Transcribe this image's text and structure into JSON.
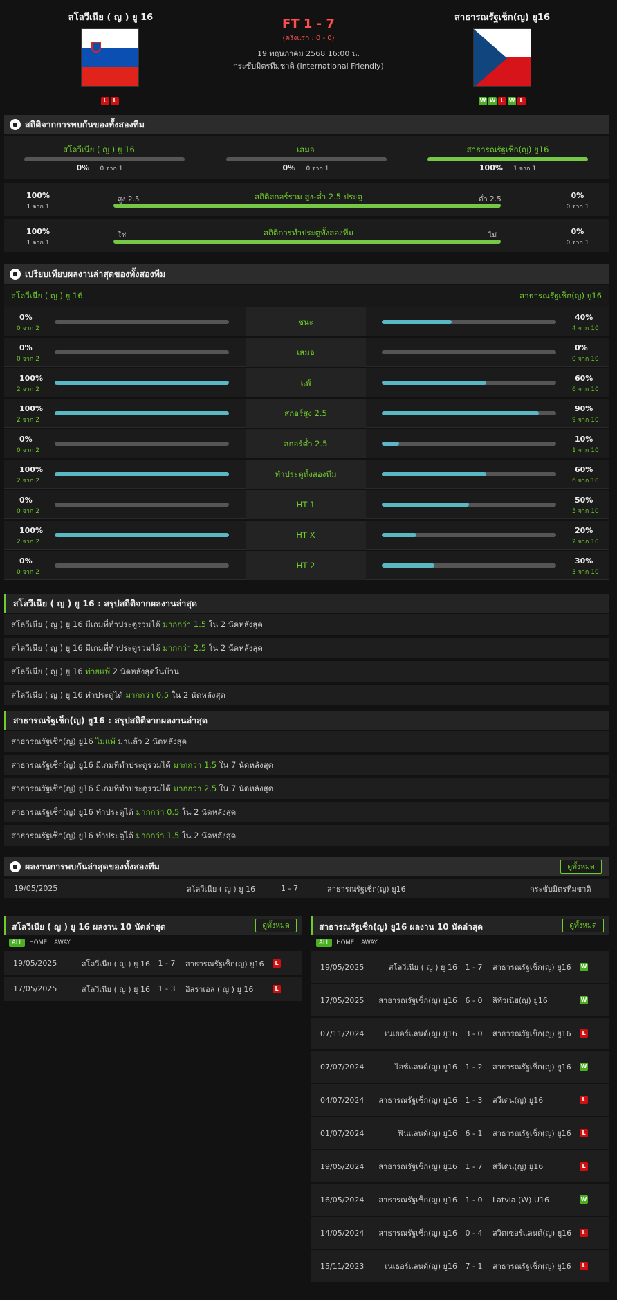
{
  "match": {
    "home_team": "สโลวีเนีย ( ญ ) ยู 16",
    "away_team": "สาธารณรัฐเช็ก(ญ) ยู16",
    "score": "FT 1 - 7",
    "half_time": "(ครึ่งแรก : 0 - 0)",
    "datetime": "19 พฤษภาคม 2568 16:00 น.",
    "competition": "กระชับมิตรทีมชาติ (International Friendly)",
    "home_form": [
      "L",
      "L"
    ],
    "away_form": [
      "W",
      "W",
      "L",
      "W",
      "L"
    ]
  },
  "h2h_stats": {
    "title": "สถิติจากการพบกันของทั้งสองทีม",
    "home_label": "สโลวีเนีย ( ญ ) ยู 16",
    "draw_label": "เสมอ",
    "away_label": "สาธารณรัฐเช็ก(ญ) ยู16",
    "home_pct": "0%",
    "home_sub": "0 จาก 1",
    "home_value": 0,
    "draw_pct": "0%",
    "draw_sub": "0 จาก 1",
    "draw_value": 0,
    "away_pct": "100%",
    "away_sub": "1 จาก 1",
    "away_value": 100,
    "ou": {
      "title": "สถิติสกอร์รวม สูง-ต่ำ 2.5 ประตู",
      "left_label": "สูง 2.5",
      "right_label": "ต่ำ 2.5",
      "left_pct": "100%",
      "left_sub": "1 จาก 1",
      "right_pct": "0%",
      "right_sub": "0 จาก 1",
      "value": 100
    },
    "btts": {
      "title": "สถิติการทำประตูทั้งสองทีม",
      "left_label": "ใช่",
      "right_label": "ไม่",
      "left_pct": "100%",
      "left_sub": "1 จาก 1",
      "right_pct": "0%",
      "right_sub": "0 จาก 1",
      "value": 100
    }
  },
  "compare": {
    "title": "เปรียบเทียบผลงานล่าสุดของทั้งสองทีม",
    "home_team": "สโลวีเนีย ( ญ ) ยู 16",
    "away_team": "สาธารณรัฐเช็ก(ญ) ยู16",
    "rows": [
      {
        "label": "ชนะ",
        "home_pct": "0%",
        "home_sub": "0 จาก 2",
        "home_value": 0,
        "away_pct": "40%",
        "away_sub": "4 จาก 10",
        "away_value": 40
      },
      {
        "label": "เสมอ",
        "home_pct": "0%",
        "home_sub": "0 จาก 2",
        "home_value": 0,
        "away_pct": "0%",
        "away_sub": "0 จาก 10",
        "away_value": 0
      },
      {
        "label": "แพ้",
        "home_pct": "100%",
        "home_sub": "2 จาก 2",
        "home_value": 100,
        "away_pct": "60%",
        "away_sub": "6 จาก 10",
        "away_value": 60
      },
      {
        "label": "สกอร์สูง 2.5",
        "home_pct": "100%",
        "home_sub": "2 จาก 2",
        "home_value": 100,
        "away_pct": "90%",
        "away_sub": "9 จาก 10",
        "away_value": 90
      },
      {
        "label": "สกอร์ต่ำ 2.5",
        "home_pct": "0%",
        "home_sub": "0 จาก 2",
        "home_value": 0,
        "away_pct": "10%",
        "away_sub": "1 จาก 10",
        "away_value": 10
      },
      {
        "label": "ทำประตูทั้งสองทีม",
        "home_pct": "100%",
        "home_sub": "2 จาก 2",
        "home_value": 100,
        "away_pct": "60%",
        "away_sub": "6 จาก 10",
        "away_value": 60
      },
      {
        "label": "HT 1",
        "home_pct": "0%",
        "home_sub": "0 จาก 2",
        "home_value": 0,
        "away_pct": "50%",
        "away_sub": "5 จาก 10",
        "away_value": 50
      },
      {
        "label": "HT X",
        "home_pct": "100%",
        "home_sub": "2 จาก 2",
        "home_value": 100,
        "away_pct": "20%",
        "away_sub": "2 จาก 10",
        "away_value": 20
      },
      {
        "label": "HT 2",
        "home_pct": "0%",
        "home_sub": "0 จาก 2",
        "home_value": 0,
        "away_pct": "30%",
        "away_sub": "3 จาก 10",
        "away_value": 30
      }
    ]
  },
  "home_summary": {
    "title": "สโลวีเนีย ( ญ ) ยู 16 : สรุปสถิติจากผลงานล่าสุด",
    "rows": [
      {
        "pre": "สโลวีเนีย ( ญ ) ยู 16  มีเกมที่ทำประตูรวมได้ ",
        "hl": "มากกว่า  1.5",
        "post": "  ใน 2 นัดหลังสุด"
      },
      {
        "pre": "สโลวีเนีย ( ญ ) ยู 16  มีเกมที่ทำประตูรวมได้ ",
        "hl": "มากกว่า  2.5",
        "post": "  ใน 2 นัดหลังสุด"
      },
      {
        "pre": "สโลวีเนีย ( ญ ) ยู 16  ",
        "hl": "พ่ายแพ้",
        "post": "  2  นัดหลังสุดในบ้าน"
      },
      {
        "pre": "สโลวีเนีย ( ญ ) ยู 16  ทำประตูได้ ",
        "hl": "มากกว่า  0.5",
        "post": "  ใน 2 นัดหลังสุด"
      }
    ]
  },
  "away_summary": {
    "title": "สาธารณรัฐเช็ก(ญ) ยู16 : สรุปสถิติจากผลงานล่าสุด",
    "rows": [
      {
        "pre": "สาธารณรัฐเช็ก(ญ) ยู16  ",
        "hl": "ไม่แพ้",
        "post": "  มาแล้ว 2 นัดหลังสุด"
      },
      {
        "pre": "สาธารณรัฐเช็ก(ญ) ยู16  มีเกมที่ทำประตูรวมได้ ",
        "hl": "มากกว่า  1.5",
        "post": "  ใน 7 นัดหลังสุด"
      },
      {
        "pre": "สาธารณรัฐเช็ก(ญ) ยู16  มีเกมที่ทำประตูรวมได้ ",
        "hl": "มากกว่า  2.5",
        "post": "  ใน 7 นัดหลังสุด"
      },
      {
        "pre": "สาธารณรัฐเช็ก(ญ) ยู16  ทำประตูได้ ",
        "hl": "มากกว่า  0.5",
        "post": "  ใน 2 นัดหลังสุด"
      },
      {
        "pre": "สาธารณรัฐเช็ก(ญ) ยู16  ทำประตูได้ ",
        "hl": "มากกว่า  1.5",
        "post": "  ใน 2 นัดหลังสุด"
      }
    ]
  },
  "h2h_results": {
    "title": "ผลงานการพบกันล่าสุดของทั้งสองทีม",
    "view_all": "ดูทั้งหมด",
    "rows": [
      {
        "date": "19/05/2025",
        "home": "สโลวีเนีย ( ญ ) ยู 16",
        "score": "1 - 7",
        "away": "สาธารณรัฐเช็ก(ญ) ยู16",
        "comp": "กระชับมิตรทีมชาติ"
      }
    ]
  },
  "home_last10": {
    "title": "สโลวีเนีย ( ญ ) ยู 16 ผลงาน 10 นัดล่าสุด",
    "view_all": "ดูทั้งหมด",
    "tabs": [
      "ALL",
      "HOME",
      "AWAY"
    ],
    "rows": [
      {
        "date": "19/05/2025",
        "home": "สโลวีเนีย ( ญ ) ยู 16",
        "score": "1 - 7",
        "away": "สาธารณรัฐเช็ก(ญ) ยู16",
        "res": "L"
      },
      {
        "date": "17/05/2025",
        "home": "สโลวีเนีย ( ญ ) ยู 16",
        "score": "1 - 3",
        "away": "อิสราเอล ( ญ ) ยู 16",
        "res": "L"
      }
    ]
  },
  "away_last10": {
    "title": "สาธารณรัฐเช็ก(ญ) ยู16 ผลงาน 10 นัดล่าสุด",
    "view_all": "ดูทั้งหมด",
    "tabs": [
      "ALL",
      "HOME",
      "AWAY"
    ],
    "rows": [
      {
        "date": "19/05/2025",
        "home": "สโลวีเนีย ( ญ ) ยู 16",
        "score": "1 - 7",
        "away": "สาธารณรัฐเช็ก(ญ) ยู16",
        "res": "W"
      },
      {
        "date": "17/05/2025",
        "home": "สาธารณรัฐเช็ก(ญ) ยู16",
        "score": "6 - 0",
        "away": "ลิทัวเนีย(ญ) ยู16",
        "res": "W"
      },
      {
        "date": "07/11/2024",
        "home": "เนเธอร์แลนด์(ญ) ยู16",
        "score": "3 - 0",
        "away": "สาธารณรัฐเช็ก(ญ) ยู16",
        "res": "L"
      },
      {
        "date": "07/07/2024",
        "home": "ไอซ์แลนด์(ญ) ยู16",
        "score": "1 - 2",
        "away": "สาธารณรัฐเช็ก(ญ) ยู16",
        "res": "W"
      },
      {
        "date": "04/07/2024",
        "home": "สาธารณรัฐเช็ก(ญ) ยู16",
        "score": "1 - 3",
        "away": "สวีเดน(ญ) ยู16",
        "res": "L"
      },
      {
        "date": "01/07/2024",
        "home": "ฟินแลนด์(ญ) ยู16",
        "score": "6 - 1",
        "away": "สาธารณรัฐเช็ก(ญ) ยู16",
        "res": "L"
      },
      {
        "date": "19/05/2024",
        "home": "สาธารณรัฐเช็ก(ญ) ยู16",
        "score": "1 - 7",
        "away": "สวีเดน(ญ) ยู16",
        "res": "L"
      },
      {
        "date": "16/05/2024",
        "home": "สาธารณรัฐเช็ก(ญ) ยู16",
        "score": "1 - 0",
        "away": "Latvia (W) U16",
        "res": "W"
      },
      {
        "date": "14/05/2024",
        "home": "สาธารณรัฐเช็ก(ญ) ยู16",
        "score": "0 - 4",
        "away": "สวิตเซอร์แลนด์(ญ) ยู16",
        "res": "L"
      },
      {
        "date": "15/11/2023",
        "home": "เนเธอร์แลนด์(ญ) ยู16",
        "score": "7 - 1",
        "away": "สาธารณรัฐเช็ก(ญ) ยู16",
        "res": "L"
      }
    ]
  },
  "colors": {
    "accent": "#6fcc2a",
    "score": "#ff4d4d",
    "bar_cyan": "#5ab8c4",
    "win": "#4caf22",
    "loss": "#d01010"
  }
}
